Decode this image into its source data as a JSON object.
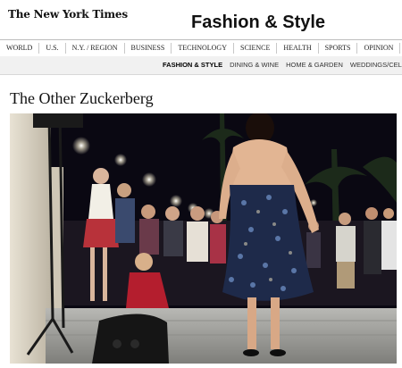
{
  "masthead": {
    "logo_text": "The New York Times",
    "section_title": "Fashion & Style"
  },
  "nav": {
    "items": [
      "WORLD",
      "U.S.",
      "N.Y. / REGION",
      "BUSINESS",
      "TECHNOLOGY",
      "SCIENCE",
      "HEALTH",
      "SPORTS",
      "OPINION"
    ]
  },
  "subnav": {
    "items": [
      "FASHION & STYLE",
      "DINING & WINE",
      "HOME & GARDEN",
      "WEDDINGS/CELEB"
    ],
    "active": "FASHION & STYLE"
  },
  "article": {
    "headline": "The Other Zuckerberg"
  },
  "photo": {
    "subject": "woman in strapless floral dress on stage at night party",
    "colors": {
      "dress": "#1e2a4a",
      "floor": "#9a9a98",
      "sky": "#0a0812"
    }
  }
}
